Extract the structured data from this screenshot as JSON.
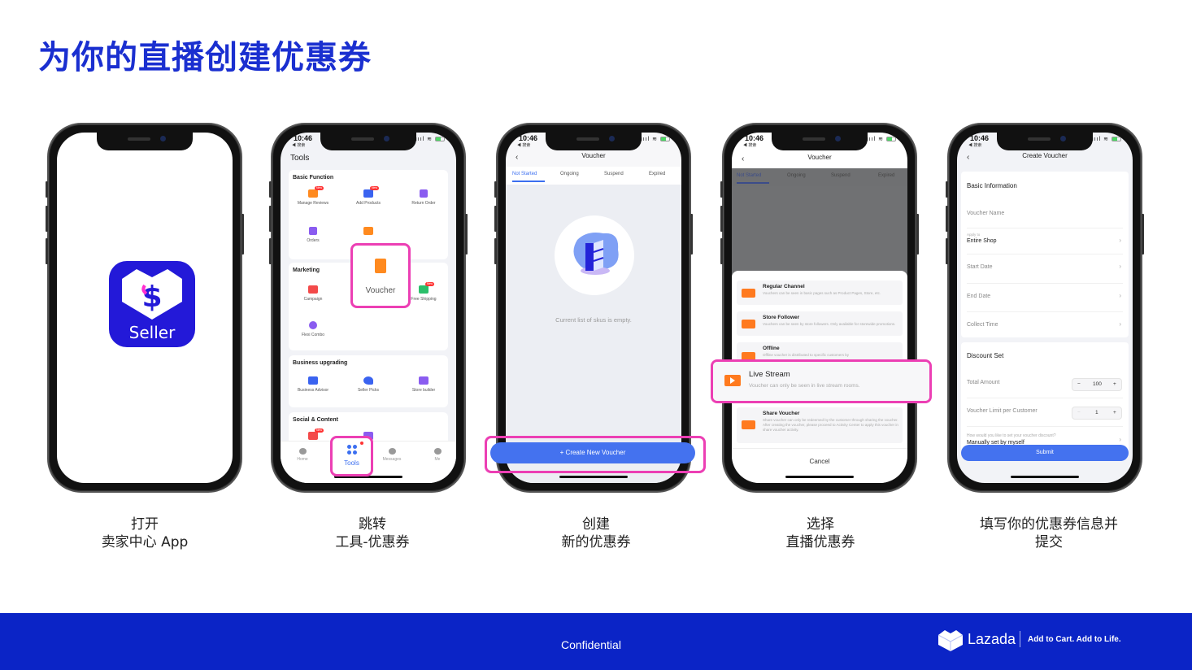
{
  "title": "为你的直播创建优惠券",
  "status_bar": {
    "time": "10:46",
    "back_app": "◀ 搜索",
    "signal": "ıııl ≋"
  },
  "phones": {
    "open_app": {
      "app_label": "Seller",
      "caption_line1": "打开",
      "caption_line2": "卖家中心 App"
    },
    "tools": {
      "page_title": "Tools",
      "sections": [
        {
          "title": "Basic Function",
          "items": [
            {
              "label": "Manage Reviews",
              "badge": "New",
              "color": "#ff8a1f"
            },
            {
              "label": "Add Products",
              "badge": "New",
              "color": "#3a63f0"
            },
            {
              "label": "Return Order",
              "badge": "",
              "color": "#8a5cf0"
            },
            {
              "label": "Orders",
              "badge": "",
              "color": "#8a5cf0"
            },
            {
              "label": "",
              "badge": "",
              "color": "#ff8a1f"
            }
          ]
        },
        {
          "title": "Marketing",
          "items": [
            {
              "label": "Campaign",
              "badge": "",
              "color": "#f34a4a"
            },
            {
              "label": "Voucher",
              "badge": "",
              "color": "#ff8a1f"
            },
            {
              "label": "Free Shipping",
              "badge": "New",
              "color": "#2bbf6a"
            },
            {
              "label": "Flexi Combo",
              "badge": "",
              "color": "#8a5cf0"
            }
          ]
        },
        {
          "title": "Business upgrading",
          "items": [
            {
              "label": "Business Advisor",
              "badge": "",
              "color": "#3a63f0"
            },
            {
              "label": "Seller Picks",
              "badge": "",
              "color": "#3a63f0"
            },
            {
              "label": "Store builder",
              "badge": "",
              "color": "#8a5cf0"
            }
          ]
        },
        {
          "title": "Social & Content",
          "items": [
            {
              "label": "",
              "badge": "New",
              "color": "#f34a4a"
            },
            {
              "label": "",
              "badge": "",
              "color": "#8a5cf0"
            }
          ]
        }
      ],
      "tabbar": [
        "Home",
        "Tools",
        "Messages",
        "Me"
      ],
      "highlight_voucher": "Voucher",
      "caption_line1": "跳转",
      "caption_line2": "工具-优惠券"
    },
    "voucher_list": {
      "nav_title": "Voucher",
      "tabs": [
        "Not Started",
        "Ongoing",
        "Suspend",
        "Expired"
      ],
      "active_tab": "Not Started",
      "empty_text": "Current list of skus is empty.",
      "create_button": "+ Create New Voucher",
      "caption_line1": "创建",
      "caption_line2": "新的优惠券"
    },
    "voucher_channel": {
      "nav_title": "Voucher",
      "tabs": [
        "Not Started",
        "Ongoing",
        "Suspend",
        "Expired"
      ],
      "options": [
        {
          "title": "Regular Channel",
          "desc": "Vouchers can be seen in basic pages such as Product Pages, Store, etc."
        },
        {
          "title": "Store Follower",
          "desc": "Vouchers can be seen by store followers. Only available for storewide promotions."
        },
        {
          "title": "Offline",
          "desc": "Offline voucher is distributed to specific customers by"
        },
        {
          "title": "Live Stream",
          "desc": "Voucher can only be seen in live stream rooms."
        },
        {
          "title": "Share Voucher",
          "desc": "Share voucher can only be redeemed by the customer through sharing the voucher. After creating the voucher, please proceed to Activity Center to apply this voucher in share voucher activity."
        }
      ],
      "cancel_label": "Cancel",
      "caption_line1": "选择",
      "caption_line2": "直播优惠券"
    },
    "create_voucher": {
      "nav_title": "Create Voucher",
      "basic_info_title": "Basic Information",
      "voucher_name_placeholder": "Voucher Name",
      "apply_to_label": "Apply to",
      "apply_to_value": "Entire Shop",
      "start_date": "Start Date",
      "end_date": "End Date",
      "collect_time": "Collect Time",
      "discount_title": "Discount Set",
      "total_amount_label": "Total Amount",
      "total_amount_value": "100",
      "limit_label": "Voucher Limit per Customer",
      "limit_value": "1",
      "discount_question": "How would you like to set your voucher discount?",
      "discount_value": "Manually set by myself",
      "submit_label": "Submit",
      "caption_line1": "填写你的优惠券信息并",
      "caption_line2": "提交"
    }
  },
  "footer": {
    "confidential": "Confidential",
    "brand": "Lazada",
    "tagline": "Add to Cart. Add to Life."
  },
  "colors": {
    "title_blue": "#1a2fd0",
    "footer_blue": "#0b24c6",
    "highlight_pink": "#ec3fb4",
    "button_blue": "#4472ef"
  }
}
